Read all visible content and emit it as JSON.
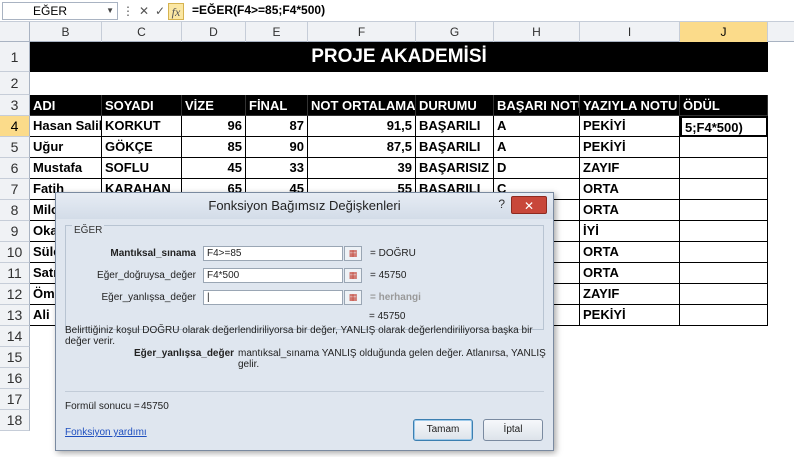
{
  "formula_bar": {
    "name_box": "EĞER",
    "fx": "fx",
    "cancel": "✕",
    "enter": "✓",
    "formula": "=EĞER(F4>=85;F4*500)"
  },
  "columns": [
    "B",
    "C",
    "D",
    "E",
    "F",
    "G",
    "H",
    "I",
    "J"
  ],
  "rows": [
    "1",
    "2",
    "3",
    "4",
    "5",
    "6",
    "7",
    "8",
    "9",
    "10",
    "11",
    "12",
    "13",
    "14",
    "15",
    "16",
    "17",
    "18"
  ],
  "sheet": {
    "title": "PROJE AKADEMİSİ",
    "headers": [
      "ADI",
      "SOYADI",
      "VİZE",
      "FİNAL",
      "NOT ORTALAMA",
      "DURUMU",
      "BAŞARI NOTU",
      "YAZIYLA NOTU",
      "ÖDÜL"
    ],
    "data": [
      {
        "adi": "Hasan Salih",
        "soyadi": "KORKUT",
        "vize": "96",
        "final": "87",
        "ort": "91,5",
        "durum": "BAŞARILI",
        "notu": "A",
        "yazi": "PEKİYİ",
        "odul": "5;F4*500)"
      },
      {
        "adi": "Uğur",
        "soyadi": "GÖKÇE",
        "vize": "85",
        "final": "90",
        "ort": "87,5",
        "durum": "BAŞARILI",
        "notu": "A",
        "yazi": "PEKİYİ",
        "odul": ""
      },
      {
        "adi": "Mustafa",
        "soyadi": "SOFLU",
        "vize": "45",
        "final": "33",
        "ort": "39",
        "durum": "BAŞARISIZ",
        "notu": "D",
        "yazi": "ZAYIF",
        "odul": ""
      },
      {
        "adi": "Fatih",
        "soyadi": "KARAHAN",
        "vize": "65",
        "final": "45",
        "ort": "55",
        "durum": "BAŞARILI",
        "notu": "C",
        "yazi": "ORTA",
        "odul": ""
      },
      {
        "adi": "Milo",
        "soyadi": "",
        "vize": "",
        "final": "",
        "ort": "",
        "durum": "",
        "notu": "",
        "yazi": "ORTA",
        "odul": ""
      },
      {
        "adi": "Oka",
        "soyadi": "",
        "vize": "",
        "final": "",
        "ort": "",
        "durum": "",
        "notu": "",
        "yazi": "İYİ",
        "odul": ""
      },
      {
        "adi": "Süle",
        "soyadi": "",
        "vize": "",
        "final": "",
        "ort": "",
        "durum": "",
        "notu": "",
        "yazi": "ORTA",
        "odul": ""
      },
      {
        "adi": "Satıl",
        "soyadi": "",
        "vize": "",
        "final": "",
        "ort": "",
        "durum": "",
        "notu": "",
        "yazi": "ORTA",
        "odul": ""
      },
      {
        "adi": "Öme",
        "soyadi": "",
        "vize": "",
        "final": "",
        "ort": "",
        "durum": "",
        "notu": "",
        "yazi": "ZAYIF",
        "odul": ""
      },
      {
        "adi": "Ali",
        "soyadi": "",
        "vize": "",
        "final": "",
        "ort": "",
        "durum": "",
        "notu": "",
        "yazi": "PEKİYİ",
        "odul": ""
      }
    ]
  },
  "dialog": {
    "title": "Fonksiyon Bağımsız Değişkenleri",
    "help": "?",
    "close": "✕",
    "group": "EĞER",
    "args": [
      {
        "label": "Mantıksal_sınama",
        "value": "F4>=85",
        "result": "= DOĞRU"
      },
      {
        "label": "Eğer_doğruysa_değer",
        "value": "F4*500",
        "result": "= 45750"
      },
      {
        "label": "Eğer_yanlışsa_değer",
        "value": "",
        "result": "= herhangi"
      }
    ],
    "total": "= 45750",
    "description": "Belirttiğiniz koşul DOĞRU olarak değerlendiriliyorsa bir değer, YANLIŞ olarak değerlendiriliyorsa başka bir değer verir.",
    "arg_name": "Eğer_yanlışsa_değer",
    "arg_desc": "mantıksal_sınama YANLIŞ olduğunda gelen değer. Atlanırsa, YANLIŞ gelir.",
    "result_label": "Formül sonucu =",
    "result_value": "45750",
    "help_link": "Fonksiyon yardımı",
    "ok": "Tamam",
    "cancel": "İptal"
  }
}
